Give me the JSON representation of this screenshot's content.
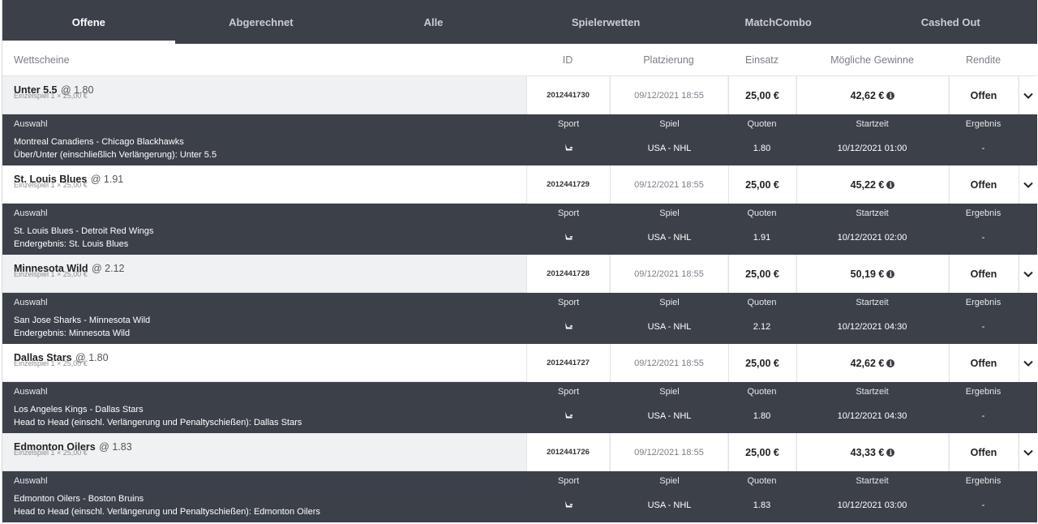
{
  "tabs": [
    "Offene",
    "Abgerechnet",
    "Alle",
    "Spielerwetten",
    "MatchCombo",
    "Cashed Out"
  ],
  "header": {
    "wettscheine": "Wettscheine",
    "id": "ID",
    "platzierung": "Platzierung",
    "einsatz": "Einsatz",
    "gewinne": "Mögliche Gewinne",
    "rendite": "Rendite"
  },
  "detail_headers": {
    "auswahl": "Auswahl",
    "sport": "Sport",
    "spiel": "Spiel",
    "quoten": "Quoten",
    "startzeit": "Startzeit",
    "ergebnis": "Ergebnis"
  },
  "bets": [
    {
      "name": "Unter 5.5",
      "odds": "@ 1.80",
      "sub": "Einzelspiel 1 × 25,00 €",
      "id": "2012441730",
      "placed": "09/12/2021 18:55",
      "stake": "25,00 €",
      "win": "42,62 €",
      "status": "Offen",
      "line1": "Montreal Canadiens - Chicago Blackhawks",
      "line2": "Über/Unter (einschließlich Verlängerung): Unter 5.5",
      "spiel": "USA - NHL",
      "quote": "1.80",
      "start": "10/12/2021 01:00",
      "result": "-"
    },
    {
      "name": "St. Louis Blues",
      "odds": "@ 1.91",
      "sub": "Einzelspiel 1 × 25,00 €",
      "id": "2012441729",
      "placed": "09/12/2021 18:55",
      "stake": "25,00 €",
      "win": "45,22 €",
      "status": "Offen",
      "line1": "St. Louis Blues - Detroit Red Wings",
      "line2": "Endergebnis: St. Louis Blues",
      "spiel": "USA - NHL",
      "quote": "1.91",
      "start": "10/12/2021 02:00",
      "result": "-"
    },
    {
      "name": "Minnesota Wild",
      "odds": "@ 2.12",
      "sub": "Einzelspiel 1 × 25,00 €",
      "id": "2012441728",
      "placed": "09/12/2021 18:55",
      "stake": "25,00 €",
      "win": "50,19 €",
      "status": "Offen",
      "line1": "San Jose Sharks - Minnesota Wild",
      "line2": "Endergebnis: Minnesota Wild",
      "spiel": "USA - NHL",
      "quote": "2.12",
      "start": "10/12/2021 04:30",
      "result": "-"
    },
    {
      "name": "Dallas Stars",
      "odds": "@ 1.80",
      "sub": "Einzelspiel 1 × 25,00 €",
      "id": "2012441727",
      "placed": "09/12/2021 18:55",
      "stake": "25,00 €",
      "win": "42,62 €",
      "status": "Offen",
      "line1": "Los Angeles Kings - Dallas Stars",
      "line2": "Head to Head (einschl. Verlängerung und Penaltyschießen): Dallas Stars",
      "spiel": "USA - NHL",
      "quote": "1.80",
      "start": "10/12/2021 04:30",
      "result": "-"
    },
    {
      "name": "Edmonton Oilers",
      "odds": "@ 1.83",
      "sub": "Einzelspiel 1 × 25,00 €",
      "id": "2012441726",
      "placed": "09/12/2021 18:55",
      "stake": "25,00 €",
      "win": "43,33 €",
      "status": "Offen",
      "line1": "Edmonton Oilers - Boston Bruins",
      "line2": "Head to Head (einschl. Verlängerung und Penaltyschießen): Edmonton Oilers",
      "spiel": "USA - NHL",
      "quote": "1.83",
      "start": "10/12/2021 03:00",
      "result": "-"
    }
  ],
  "icons": {
    "sport": "ice-hockey-icon",
    "info": "info-icon",
    "expand": "chevron-down-icon"
  }
}
